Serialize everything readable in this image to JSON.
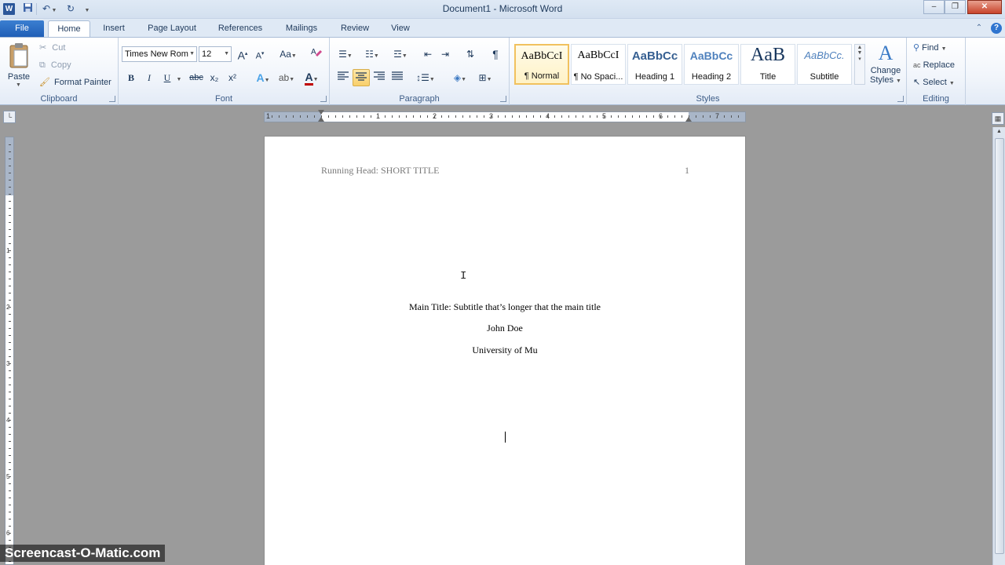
{
  "window": {
    "title": "Document1 - Microsoft Word",
    "icons": [
      "word-app-icon",
      "save-icon",
      "undo-icon",
      "redo-icon",
      "customize-qat-icon"
    ],
    "controls": [
      "minimize",
      "restore",
      "close"
    ]
  },
  "tabs": [
    {
      "label": "File"
    },
    {
      "label": "Home"
    },
    {
      "label": "Insert"
    },
    {
      "label": "Page Layout"
    },
    {
      "label": "References"
    },
    {
      "label": "Mailings"
    },
    {
      "label": "Review"
    },
    {
      "label": "View"
    }
  ],
  "active_tab": "Home",
  "ribbon": {
    "clipboard": {
      "label": "Clipboard",
      "paste": "Paste",
      "cut": "Cut",
      "copy": "Copy",
      "format_painter": "Format Painter"
    },
    "font": {
      "label": "Font",
      "font_name": "Times New Rom",
      "font_size": "12",
      "bold": "B",
      "italic": "I",
      "underline": "U",
      "strikethrough": "abc",
      "subscript": "x₂",
      "superscript": "x²",
      "grow": "A",
      "shrink": "A",
      "change_case": "Aa",
      "font_color_accent": "#c00000"
    },
    "paragraph": {
      "label": "Paragraph",
      "show_marks": "¶",
      "active_alignment": "center"
    },
    "styles": {
      "label": "Styles",
      "items": [
        {
          "sample": "AaBbCcI",
          "name": "¶ Normal",
          "selected": true
        },
        {
          "sample": "AaBbCcI",
          "name": "¶ No Spaci...",
          "selected": false
        },
        {
          "sample": "AaBbCc",
          "name": "Heading 1",
          "selected": false
        },
        {
          "sample": "AaBbCc",
          "name": "Heading 2",
          "selected": false
        },
        {
          "sample": "AaB",
          "name": "Title",
          "selected": false
        },
        {
          "sample": "AaBbCc.",
          "name": "Subtitle",
          "selected": false
        }
      ],
      "change_styles_line1": "Change",
      "change_styles_line2": "Styles"
    },
    "editing": {
      "label": "Editing",
      "find": "Find",
      "replace": "Replace",
      "select": "Select"
    }
  },
  "ruler": {
    "numbers": [
      "1",
      "1",
      "2",
      "3",
      "4",
      "5",
      "6",
      "7"
    ],
    "vertical_numbers": [
      "1",
      "2",
      "3",
      "4",
      "5",
      "6"
    ]
  },
  "document": {
    "header_left": "Running Head: SHORT TITLE",
    "header_right": "1",
    "lines": [
      "Main Title: Subtitle that’s longer that the main title",
      "John Doe",
      "University of Mu"
    ]
  },
  "watermark": "Screencast-O-Matic.com"
}
